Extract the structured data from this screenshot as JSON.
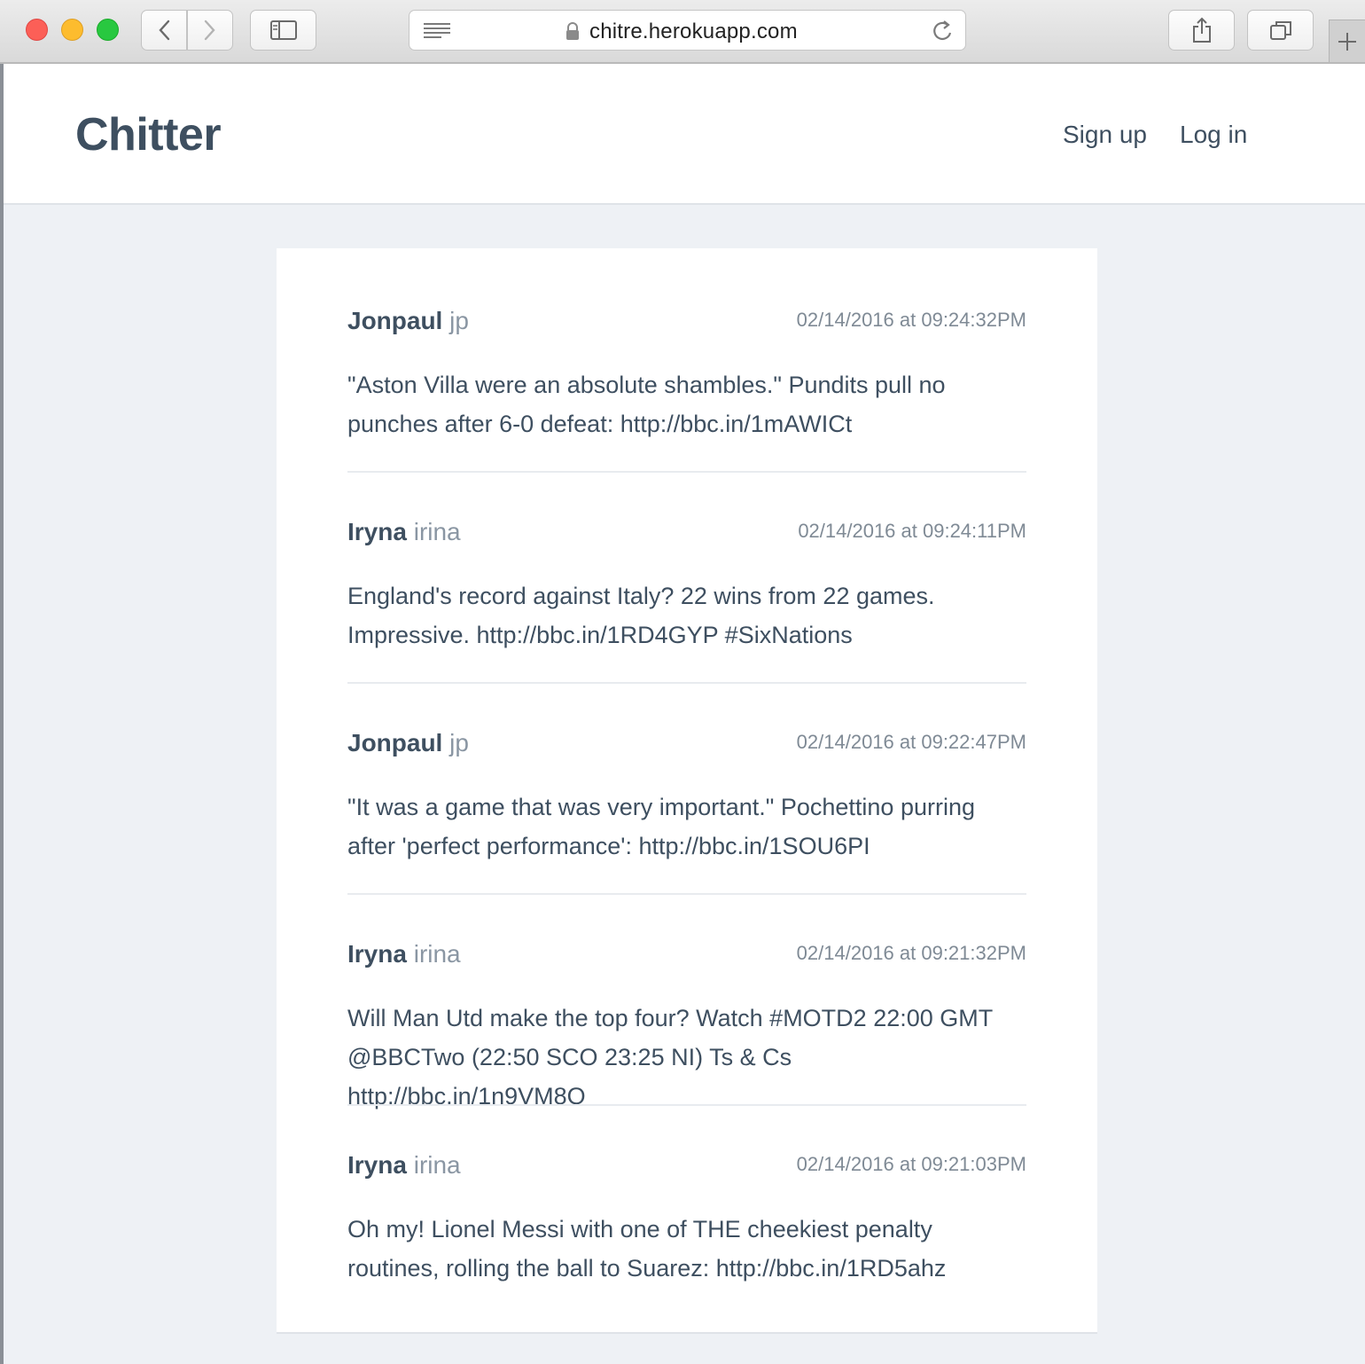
{
  "browser": {
    "url": "chitre.herokuapp.com"
  },
  "site": {
    "brand": "Chitter",
    "nav": {
      "signup": "Sign up",
      "login": "Log in"
    }
  },
  "posts": [
    {
      "name": "Jonpaul",
      "handle": "jp",
      "time": "02/14/2016 at 09:24:32PM",
      "text": "\"Aston Villa were an absolute shambles.\" Pundits pull no punches after 6-0 defeat: http://bbc.in/1mAWICt"
    },
    {
      "name": "Iryna",
      "handle": "irina",
      "time": "02/14/2016 at 09:24:11PM",
      "text": "England's record against Italy? 22 wins from 22 games. Impressive. http://bbc.in/1RD4GYP #SixNations"
    },
    {
      "name": "Jonpaul",
      "handle": "jp",
      "time": "02/14/2016 at 09:22:47PM",
      "text": "\"It was a game that was very important.\" Pochettino purring after 'perfect performance': http://bbc.in/1SOU6PI"
    },
    {
      "name": "Iryna",
      "handle": "irina",
      "time": "02/14/2016 at 09:21:32PM",
      "text": "Will Man Utd make the top four? Watch #MOTD2 22:00 GMT @BBCTwo (22:50 SCO 23:25 NI) Ts & Cs http://bbc.in/1n9VM8O"
    },
    {
      "name": "Iryna",
      "handle": "irina",
      "time": "02/14/2016 at 09:21:03PM",
      "text": "Oh my! Lionel Messi with one of THE cheekiest penalty routines, rolling the ball to Suarez: http://bbc.in/1RD5ahz"
    }
  ],
  "colors": {
    "text": "#3e4f60",
    "muted": "#8a96a3",
    "background": "#eef1f5"
  }
}
